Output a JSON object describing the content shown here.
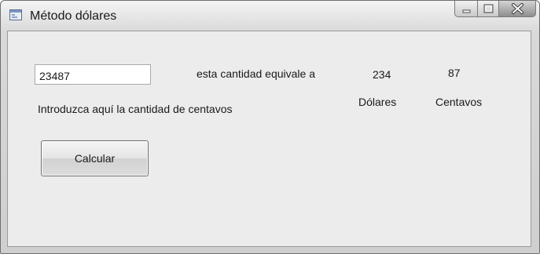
{
  "window": {
    "title": "Método dólares",
    "icon": "form-window-icon",
    "controls": [
      "minimize-icon",
      "maximize-icon",
      "close-icon"
    ]
  },
  "form": {
    "cents_input": {
      "value": "23487",
      "placeholder": ""
    },
    "equivalence_label": "esta cantidad equivale a",
    "dollars_value": "234",
    "cents_value": "87",
    "dollars_caption": "Dólares",
    "cents_caption": "Centavos",
    "instruction_label": "Introduzca aquí la cantidad de centavos",
    "calculate_button": "Calcular"
  }
}
